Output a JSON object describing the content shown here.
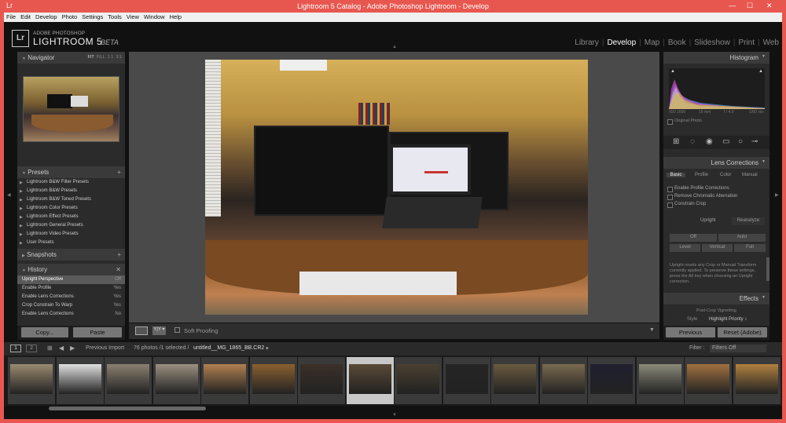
{
  "titlebar": {
    "title": "Lightroom 5 Catalog - Adobe Photoshop Lightroom - Develop",
    "min": "—",
    "max": "☐",
    "close": "✕"
  },
  "menu": [
    "File",
    "Edit",
    "Develop",
    "Photo",
    "Settings",
    "Tools",
    "View",
    "Window",
    "Help"
  ],
  "brand": {
    "logo": "Lr",
    "line1": "ADOBE PHOTOSHOP",
    "line2": "LIGHTROOM 5",
    "line3": "BETA"
  },
  "modules": [
    "Library",
    "Develop",
    "Map",
    "Book",
    "Slideshow",
    "Print",
    "Web"
  ],
  "active_module": "Develop",
  "navigator": {
    "title": "Navigator",
    "zoom": [
      "FIT",
      "FILL",
      "1:1",
      "3:1"
    ]
  },
  "presets": {
    "title": "Presets",
    "add": "+",
    "items": [
      "Lightroom B&W Filter Presets",
      "Lightroom B&W Presets",
      "Lightroom B&W Toned Presets",
      "Lightroom Color Presets",
      "Lightroom Effect Presets",
      "Lightroom General Presets",
      "Lightroom Video Presets",
      "User Presets"
    ]
  },
  "snapshots": {
    "title": "Snapshots",
    "add": "+"
  },
  "history": {
    "title": "History",
    "close": "✕",
    "items": [
      {
        "label": "Upright Perspective",
        "value": "Off"
      },
      {
        "label": "Enable Profile",
        "value": "Yes"
      },
      {
        "label": "Enable Lens Corrections",
        "value": "Yes"
      },
      {
        "label": "Crop Constrain To Warp",
        "value": "Yes"
      },
      {
        "label": "Enable Lens Corrections",
        "value": "No"
      }
    ]
  },
  "left_buttons": {
    "copy": "Copy...",
    "paste": "Paste"
  },
  "toolbar": {
    "soft_proofing": "Soft Proofing"
  },
  "histogram": {
    "title": "Histogram",
    "iso": "ISO 1600",
    "focal": "16 mm",
    "aperture": "f / 4.0",
    "shutter": "1/60 sec",
    "original": "Original Photo"
  },
  "lens": {
    "title": "Lens Corrections",
    "tabs": [
      "Basic",
      "Profile",
      "Color",
      "Manual"
    ],
    "checks": [
      "Enable Profile Corrections",
      "Remove Chromatic Aberration",
      "Constrain Crop"
    ],
    "upright": "Upright",
    "reanalyze": "Reanalyze",
    "modes": [
      "Off",
      "Auto",
      "Level",
      "Vertical",
      "Full"
    ],
    "note": "Upright resets any Crop or Manual Transform currently applied. To preserve these settings, press the Alt key when choosing an Upright correction."
  },
  "effects": {
    "title": "Effects",
    "vignette": "Post-Crop Vignetting",
    "style_label": "Style",
    "style_value": "Highlight Priority ↕"
  },
  "right_buttons": {
    "previous": "Previous",
    "reset": "Reset (Adobe)"
  },
  "filmbar": {
    "page1": "1",
    "page2": "2",
    "source": "Previous Import",
    "count": "76 photos /1 selected /",
    "filename": "untitled__MG_1865_BB.CR2",
    "dropdown": "▾",
    "filter_label": "Filter :",
    "filter_value": "Filters Off"
  },
  "film_selected_index": 7
}
